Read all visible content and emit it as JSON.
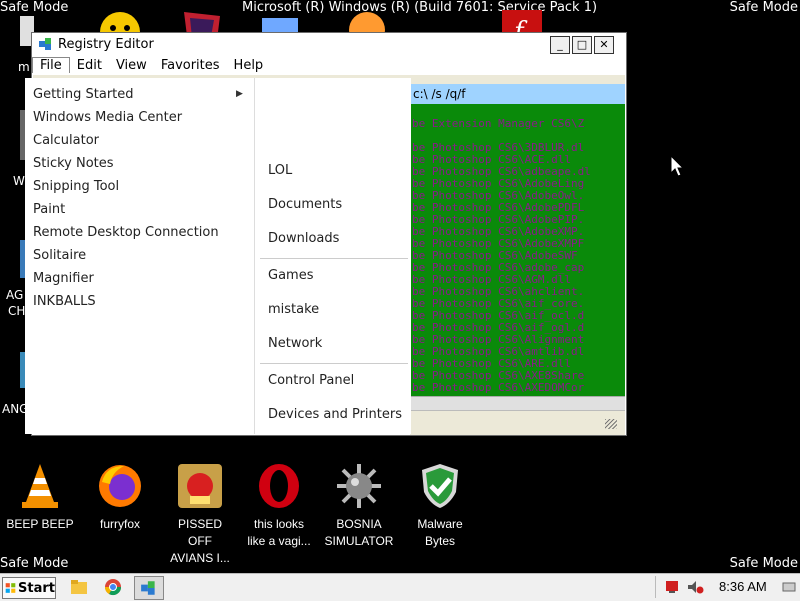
{
  "desktop": {
    "safe_mode_label": "Safe Mode",
    "os_title": "Microsoft (R) Windows (R) (Build 7601: Service Pack 1)",
    "left_labels": [
      "m",
      "W",
      "AG",
      "CH",
      "ANG"
    ],
    "icons": [
      {
        "label_line1": "BEEP BEEP",
        "label_line2": "",
        "icon": "vlc-cone-icon"
      },
      {
        "label_line1": "furryfox",
        "label_line2": "",
        "icon": "firefox-icon"
      },
      {
        "label_line1": "PISSED OFF",
        "label_line2": "AVIANS I...",
        "icon": "angry-birds-icon"
      },
      {
        "label_line1": "this looks",
        "label_line2": "like a vagi...",
        "icon": "opera-icon"
      },
      {
        "label_line1": "BOSNIA",
        "label_line2": "SIMULATOR",
        "icon": "spiked-mine-icon"
      },
      {
        "label_line1": "Malware",
        "label_line2": "Bytes",
        "icon": "shield-check-icon"
      }
    ]
  },
  "registry_editor": {
    "title": "Registry Editor",
    "menu": [
      "File",
      "Edit",
      "View",
      "Favorites",
      "Help"
    ],
    "controls": {
      "minimize": "_",
      "maximize": "□",
      "close": "✕"
    }
  },
  "cmd": {
    "title": "c:\\ /s /q/f",
    "lines": [
      "be Extension Manager CS6\\Z",
      "",
      "be Photoshop CS6\\3DBLUR.dl",
      "be Photoshop CS6\\ACE.dll",
      "be Photoshop CS6\\adbeape.dl",
      "be Photoshop CS6\\AdobeLing",
      "be Photoshop CS6\\AdobeOwl.",
      "be Photoshop CS6\\AdobePDFL",
      "be Photoshop CS6\\AdobePIP.",
      "be Photoshop CS6\\AdobeXMP.",
      "be Photoshop CS6\\AdobeXMPF",
      "be Photoshop CS6\\AdobeSWF",
      "be Photoshop CS6\\adobe_cap",
      "be Photoshop CS6\\AGM.dll",
      "be Photoshop CS6\\ahclient.",
      "be Photoshop CS6\\aif_core.",
      "be Photoshop CS6\\aif_ocl.d",
      "be Photoshop CS6\\aif_ogl.d",
      "be Photoshop CS6\\Alignment",
      "be Photoshop CS6\\amtlib.dl",
      "be Photoshop CS6\\ARE.dll",
      "be Photoshop CS6\\AXE8Share",
      "be Photoshop CS6\\AXEDOMCor"
    ]
  },
  "start_menu": {
    "programs": [
      "Getting Started",
      "Windows Media Center",
      "Calculator",
      "Sticky Notes",
      "Snipping Tool",
      "Paint",
      "Remote Desktop Connection",
      "Solitaire",
      "Magnifier",
      "INKBALLS"
    ],
    "right": [
      "LOL",
      "Documents",
      "Downloads",
      "Games",
      "mistake",
      "Network",
      "Control Panel",
      "Devices and Printers"
    ]
  },
  "taskbar": {
    "start_label": "Start",
    "clock": "8:36 AM"
  }
}
